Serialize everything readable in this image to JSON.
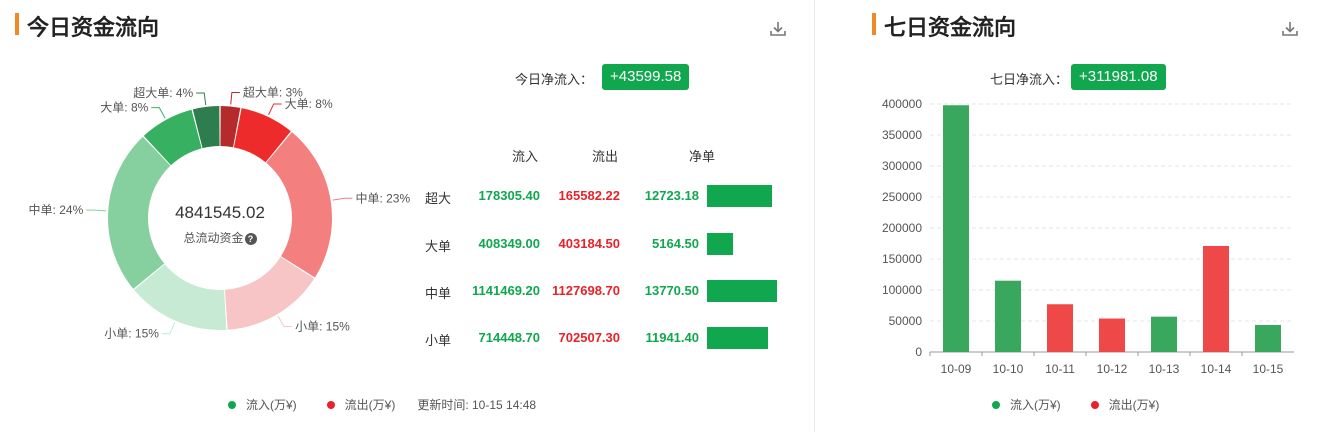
{
  "colors": {
    "inflow": "#10a74f",
    "outflow": "#e6232a",
    "accent": "#f08a24",
    "badge_bg": "#10a74f",
    "bar_green": "#3aa75e",
    "bar_red": "#ee4848"
  },
  "today": {
    "title": "今日资金流向",
    "net_label": "今日净流入：",
    "net_value": "+43599.58",
    "download_icon": "download-icon",
    "total_value": "4841545.02",
    "total_label": "总流动资金",
    "table": {
      "headers": [
        "流入",
        "流出",
        "净单"
      ],
      "rows": [
        {
          "label": "超大",
          "inflow": "178305.40",
          "outflow": "165582.22",
          "net": "12723.18",
          "net_num": 12723.18
        },
        {
          "label": "大单",
          "inflow": "408349.00",
          "outflow": "403184.50",
          "net": "5164.50",
          "net_num": 5164.5
        },
        {
          "label": "中单",
          "inflow": "1141469.20",
          "outflow": "1127698.70",
          "net": "13770.50",
          "net_num": 13770.5
        },
        {
          "label": "小单",
          "inflow": "714448.70",
          "outflow": "702507.30",
          "net": "11941.40",
          "net_num": 11941.4
        }
      ]
    },
    "legend": {
      "inflow": "流入(万¥)",
      "outflow": "流出(万¥)",
      "update_time": "更新时间: 10-15 14:48"
    }
  },
  "week": {
    "title": "七日资金流向",
    "net_label": "七日净流入：",
    "net_value": "+311981.08",
    "download_icon": "download-icon",
    "legend": {
      "inflow": "流入(万¥)",
      "outflow": "流出(万¥)"
    }
  },
  "chart_data": [
    {
      "type": "pie",
      "title": "",
      "categories": [
        "超大单",
        "大单",
        "中单",
        "小单",
        "小单",
        "中单",
        "大单",
        "超大单"
      ],
      "labels": [
        "超大单: 3%",
        "大单: 8%",
        "中单: 23%",
        "小单: 15%",
        "小单: 15%",
        "中单: 24%",
        "大单: 8%",
        "超大单: 4%"
      ],
      "values": [
        3,
        8,
        23,
        15,
        15,
        24,
        8,
        4
      ],
      "colors": [
        "#b52a2a",
        "#ee2b2b",
        "#f47f7f",
        "#f7c5c5",
        "#c6ead3",
        "#86cf9e",
        "#37b061",
        "#2e7d4f"
      ],
      "center_text": "4841545.02"
    },
    {
      "type": "bar",
      "title": "",
      "categories": [
        "10-09",
        "10-10",
        "10-11",
        "10-12",
        "10-13",
        "10-14",
        "10-15"
      ],
      "values": [
        398000,
        115000,
        77000,
        54000,
        57000,
        171000,
        43599.58
      ],
      "direction": [
        "inflow",
        "inflow",
        "outflow",
        "outflow",
        "inflow",
        "outflow",
        "inflow"
      ],
      "ylim": [
        0,
        400000
      ],
      "yticks": [
        0,
        50000,
        100000,
        150000,
        200000,
        250000,
        300000,
        350000,
        400000
      ],
      "grid": true,
      "legend": "bottom"
    }
  ]
}
